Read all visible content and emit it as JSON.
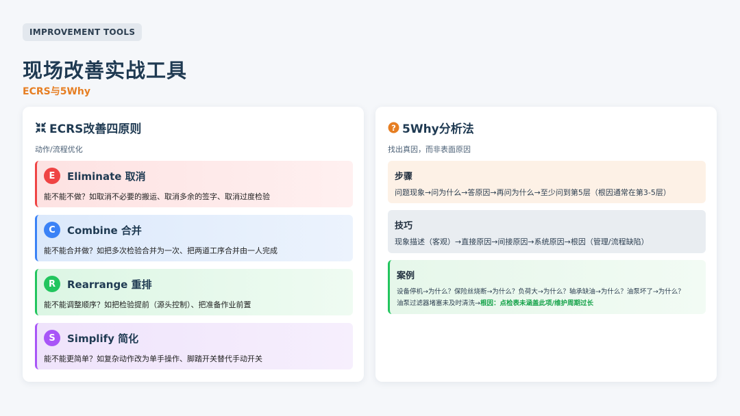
{
  "tag": "IMPROVEMENT TOOLS",
  "title": "现场改善实战工具",
  "subtitle": "ECRS与5Why",
  "colors": {
    "accent_orange": "#e67e22",
    "eliminate": "#ef4444",
    "combine": "#3b82f6",
    "rearrange": "#22c55e",
    "simplify": "#a855f7",
    "root_green": "#16a34a"
  },
  "ecrs": {
    "icon": "compress-arrows-icon",
    "title": "ECRS改善四原则",
    "subtitle": "动作/流程优化",
    "principles": [
      {
        "letter": "E",
        "name": "Eliminate 取消",
        "desc": "能不能不做？如取消不必要的搬运、取消多余的签字、取消过度检验"
      },
      {
        "letter": "C",
        "name": "Combine 合并",
        "desc": "能不能合并做？如把多次检验合并为一次、把两道工序合并由一人完成"
      },
      {
        "letter": "R",
        "name": "Rearrange 重排",
        "desc": "能不能调整顺序？如把检验提前（源头控制）、把准备作业前置"
      },
      {
        "letter": "S",
        "name": "Simplify 简化",
        "desc": "能不能更简单？如复杂动作改为单手操作、脚踏开关替代手动开关"
      }
    ]
  },
  "why5": {
    "icon": "question-circle-icon",
    "title": "5Why分析法",
    "subtitle": "找出真因，而非表面原因",
    "steps": {
      "title": "步骤",
      "text": "问题现象→问为什么→答原因→再问为什么→至少问到第5层（根因通常在第3-5层）"
    },
    "tips": {
      "title": "技巧",
      "text": "现象描述（客观）→直接原因→间接原因→系统原因→根因（管理/流程缺陷）"
    },
    "case": {
      "title": "案例",
      "line1": "设备停机→为什么？保险丝烧断→为什么？负荷大→为什么？轴承缺油→为什么？油泵坏了→为什么？",
      "line2_prefix": "油泵过滤器堵塞未及时清洗→",
      "root": "根因：点检表未涵盖此项/维护周期过长"
    }
  }
}
